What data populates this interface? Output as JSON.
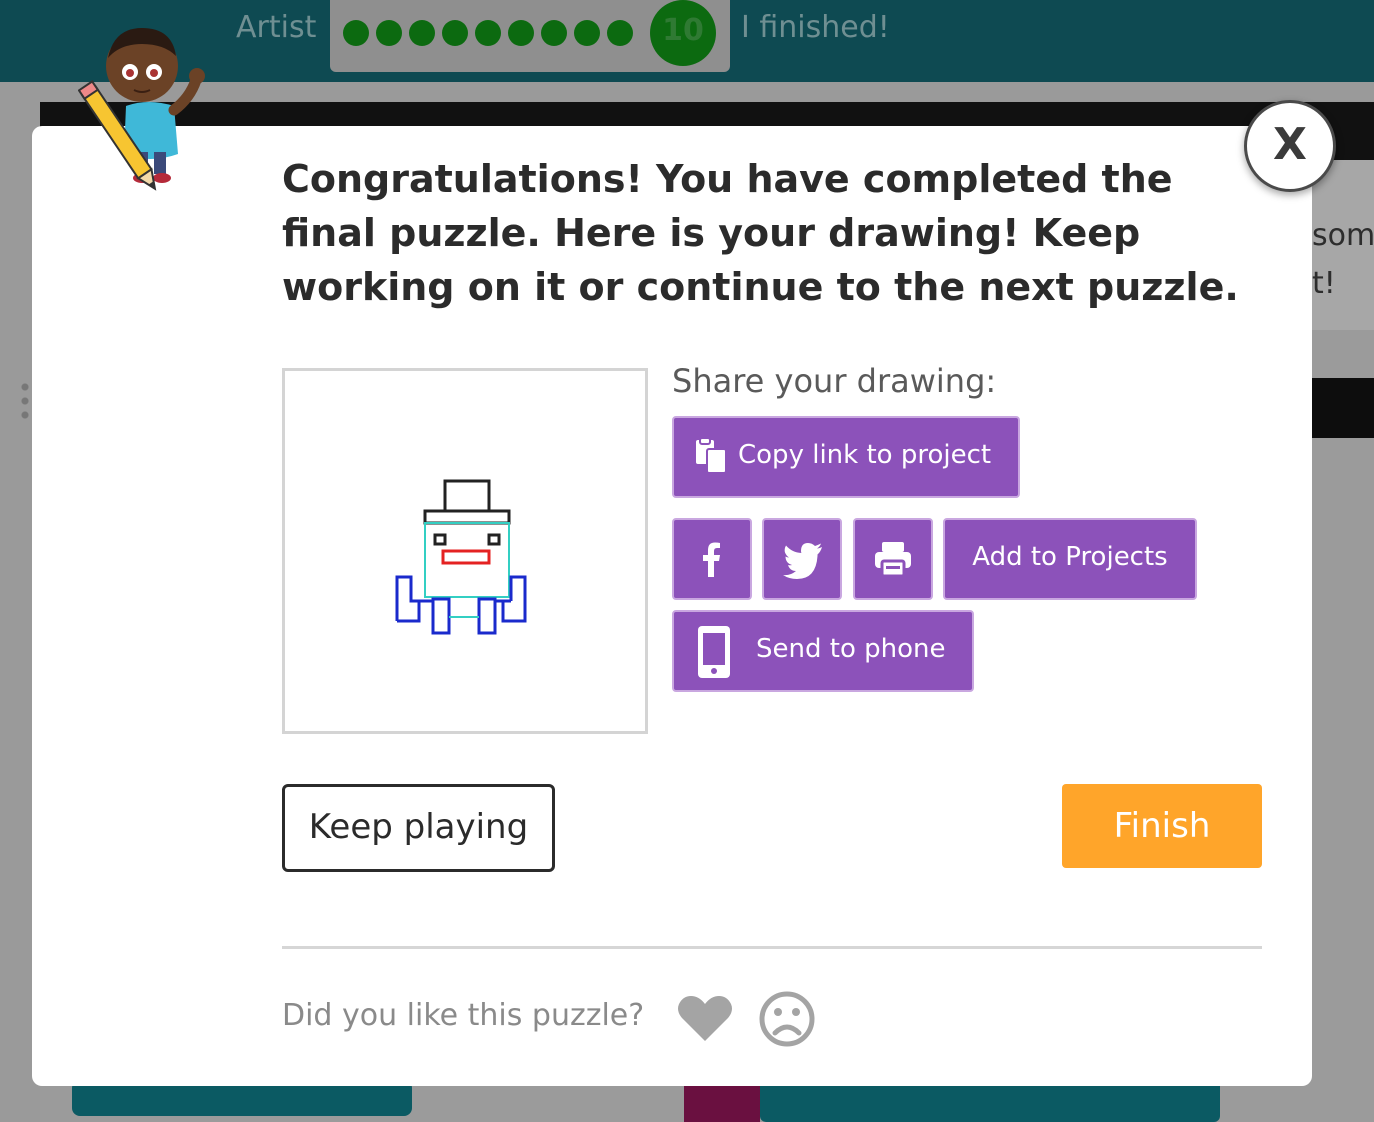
{
  "header": {
    "app_title": "Artist",
    "current_level": "10",
    "finished_label": "I finished!"
  },
  "background": {
    "partial_text_line1": "some",
    "partial_text_line2": "t!"
  },
  "dialog": {
    "close_label": "X",
    "message": "Congratulations! You have completed the final puzzle. Here is your drawing! Keep working on it or continue to the next puzzle.",
    "share_heading": "Share your drawing:",
    "copy_link_label": "Copy link to project",
    "add_to_projects_label": "Add to Projects",
    "send_to_phone_label": "Send to phone",
    "keep_playing_label": "Keep playing",
    "finish_label": "Finish",
    "feedback_question": "Did you like this puzzle?"
  },
  "icons": {
    "copy": "clipboard-icon",
    "facebook": "facebook-icon",
    "twitter": "twitter-icon",
    "print": "printer-icon",
    "phone": "mobile-phone-icon",
    "like": "heart-icon",
    "dislike": "frown-icon"
  },
  "colors": {
    "purple": "#8c52ba",
    "orange": "#ffa52a",
    "header_bg": "#0e4a52",
    "progress_green": "#0c6a10"
  },
  "progress": {
    "completed_dots": 9,
    "current": 10
  }
}
